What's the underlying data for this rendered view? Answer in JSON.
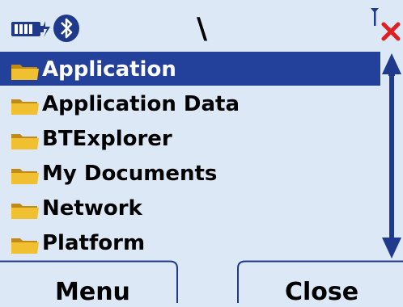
{
  "status": {
    "path": "\\",
    "icons": [
      "battery-icon",
      "bluetooth-icon",
      "signal-off-icon"
    ]
  },
  "files": [
    {
      "name": "Application",
      "selected": true
    },
    {
      "name": "Application Data",
      "selected": false
    },
    {
      "name": "BTExplorer",
      "selected": false
    },
    {
      "name": "My Documents",
      "selected": false
    },
    {
      "name": "Network",
      "selected": false
    },
    {
      "name": "Platform",
      "selected": false
    }
  ],
  "softkeys": {
    "left": "Menu",
    "right": "Close"
  },
  "colors": {
    "background": "#dce8f6",
    "selection": "#23409a",
    "accent": "#1f3a8c",
    "folder": "#f0c030",
    "error": "#e02020"
  }
}
